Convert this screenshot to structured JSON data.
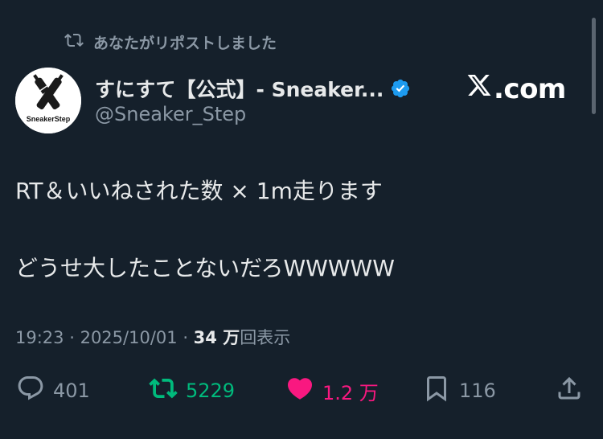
{
  "repost_notice": "あなたがリポストしました",
  "author": {
    "display_name": "すにすて【公式】- Sneaker...",
    "handle": "@Sneaker_Step",
    "avatar_text": "SneakerStep"
  },
  "site_logo": ".com",
  "tweet": {
    "line1": "RT＆いいねされた数 × 1m走ります",
    "line2": "どうせ大したことないだろWWWWW"
  },
  "meta": {
    "time": "19:23",
    "date": "2025/10/01",
    "views_count": "34 万",
    "views_label": "回表示"
  },
  "actions": {
    "replies": "401",
    "retweets": "5229",
    "likes": "1.2 万",
    "bookmarks": "116"
  },
  "colors": {
    "background": "#15202b",
    "retweet": "#00ba7c",
    "like": "#f91880",
    "verified": "#1d9bf0"
  }
}
